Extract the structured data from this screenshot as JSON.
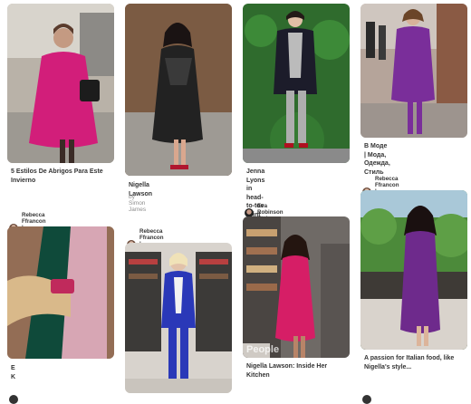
{
  "pins": [
    {
      "caption": "5 Estilos De Abrigos Para Este Invierno",
      "attribution": "Rebecca Ffrancon | Personal Stylist"
    },
    {
      "caption": "E K"
    },
    {
      "caption": "Nigella Lawson",
      "sub": "by Simon James",
      "attribution": "Rebecca Ffrancon | Personal Stylist"
    },
    {
      "caption": ""
    },
    {
      "caption": "Jenna Lyons in head-to-toe print",
      "attribution": "Eva Robinson Styl"
    },
    {
      "caption": "Nigella Lawson: Inside Her Kitchen"
    },
    {
      "caption": "В Моде | Мода, Одежда, Стиль",
      "attribution": "Rebecca Ffrancon | Personal Stylist"
    },
    {
      "caption": "A passion for Italian food, like Nigella's style..."
    }
  ],
  "image_labels": {
    "kitchen_text": "People"
  }
}
